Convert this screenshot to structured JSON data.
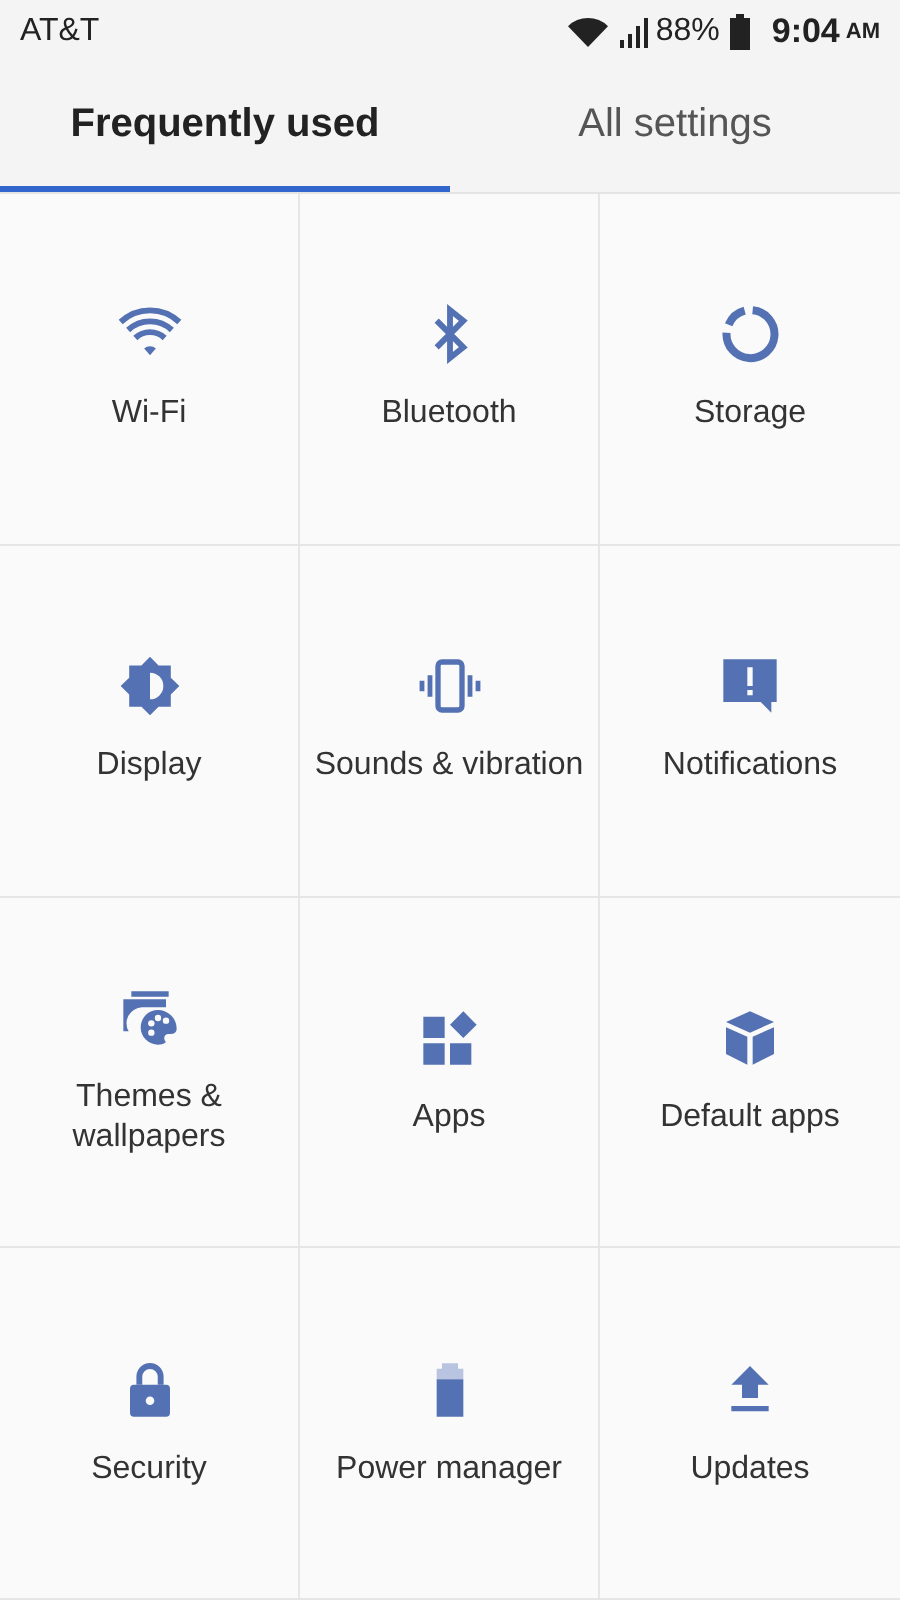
{
  "status_bar": {
    "carrier": "AT&T",
    "battery": "88%",
    "time": "9:04",
    "meridiem": "AM"
  },
  "tabs": [
    {
      "label": "Frequently used",
      "selected": true
    },
    {
      "label": "All settings",
      "selected": false
    }
  ],
  "tiles": [
    {
      "label": "Wi-Fi",
      "kind": "wifi"
    },
    {
      "label": "Bluetooth",
      "kind": "bluetooth"
    },
    {
      "label": "Storage",
      "kind": "storage"
    },
    {
      "label": "Display",
      "kind": "display"
    },
    {
      "label": "Sounds & vibration",
      "kind": "vibration"
    },
    {
      "label": "Notifications",
      "kind": "notification"
    },
    {
      "label": "Themes & wallpapers",
      "kind": "themes"
    },
    {
      "label": "Apps",
      "kind": "apps"
    },
    {
      "label": "Default apps",
      "kind": "cube"
    },
    {
      "label": "Security",
      "kind": "lock"
    },
    {
      "label": "Power manager",
      "kind": "battery"
    },
    {
      "label": "Updates",
      "kind": "upload"
    }
  ]
}
